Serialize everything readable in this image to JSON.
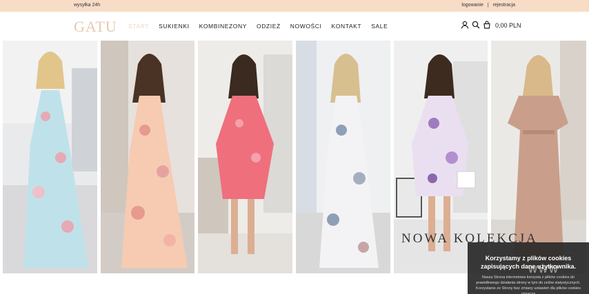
{
  "topbar": {
    "shipping": "wysyłka 24h",
    "login": "logowanie",
    "separator": "|",
    "register": "rejestracja"
  },
  "header": {
    "logo": "GATU",
    "nav": [
      {
        "label": "START"
      },
      {
        "label": "SUKIENKI"
      },
      {
        "label": "KOMBINEZONY"
      },
      {
        "label": "ODZIEŻ"
      },
      {
        "label": "NOWOŚCI"
      },
      {
        "label": "KONTAKT"
      },
      {
        "label": "SALE"
      }
    ],
    "active_nav": "START",
    "cart_total": "0,00 PLN"
  },
  "hero": {
    "banner_text": "NOWA KOLEKCJA"
  },
  "cookie": {
    "title": "Korzystamy z plików cookies zapisujących dane użytkownika.",
    "body": "Nasza Strona internetowa korzysta z plików cookies do prawidłowego działania strony w tym do celów statystycznych. Korzystanie ze Strony bez zmiany ustawień dla plików cookies oznacza",
    "watermark": "www"
  },
  "colors": {
    "topbar": "#f7dcc6",
    "logo": "#e6c9ad",
    "active_nav": "#eed6c0",
    "cookie_bg": "#282828"
  },
  "icons": [
    "user-icon",
    "search-icon",
    "bag-icon"
  ]
}
